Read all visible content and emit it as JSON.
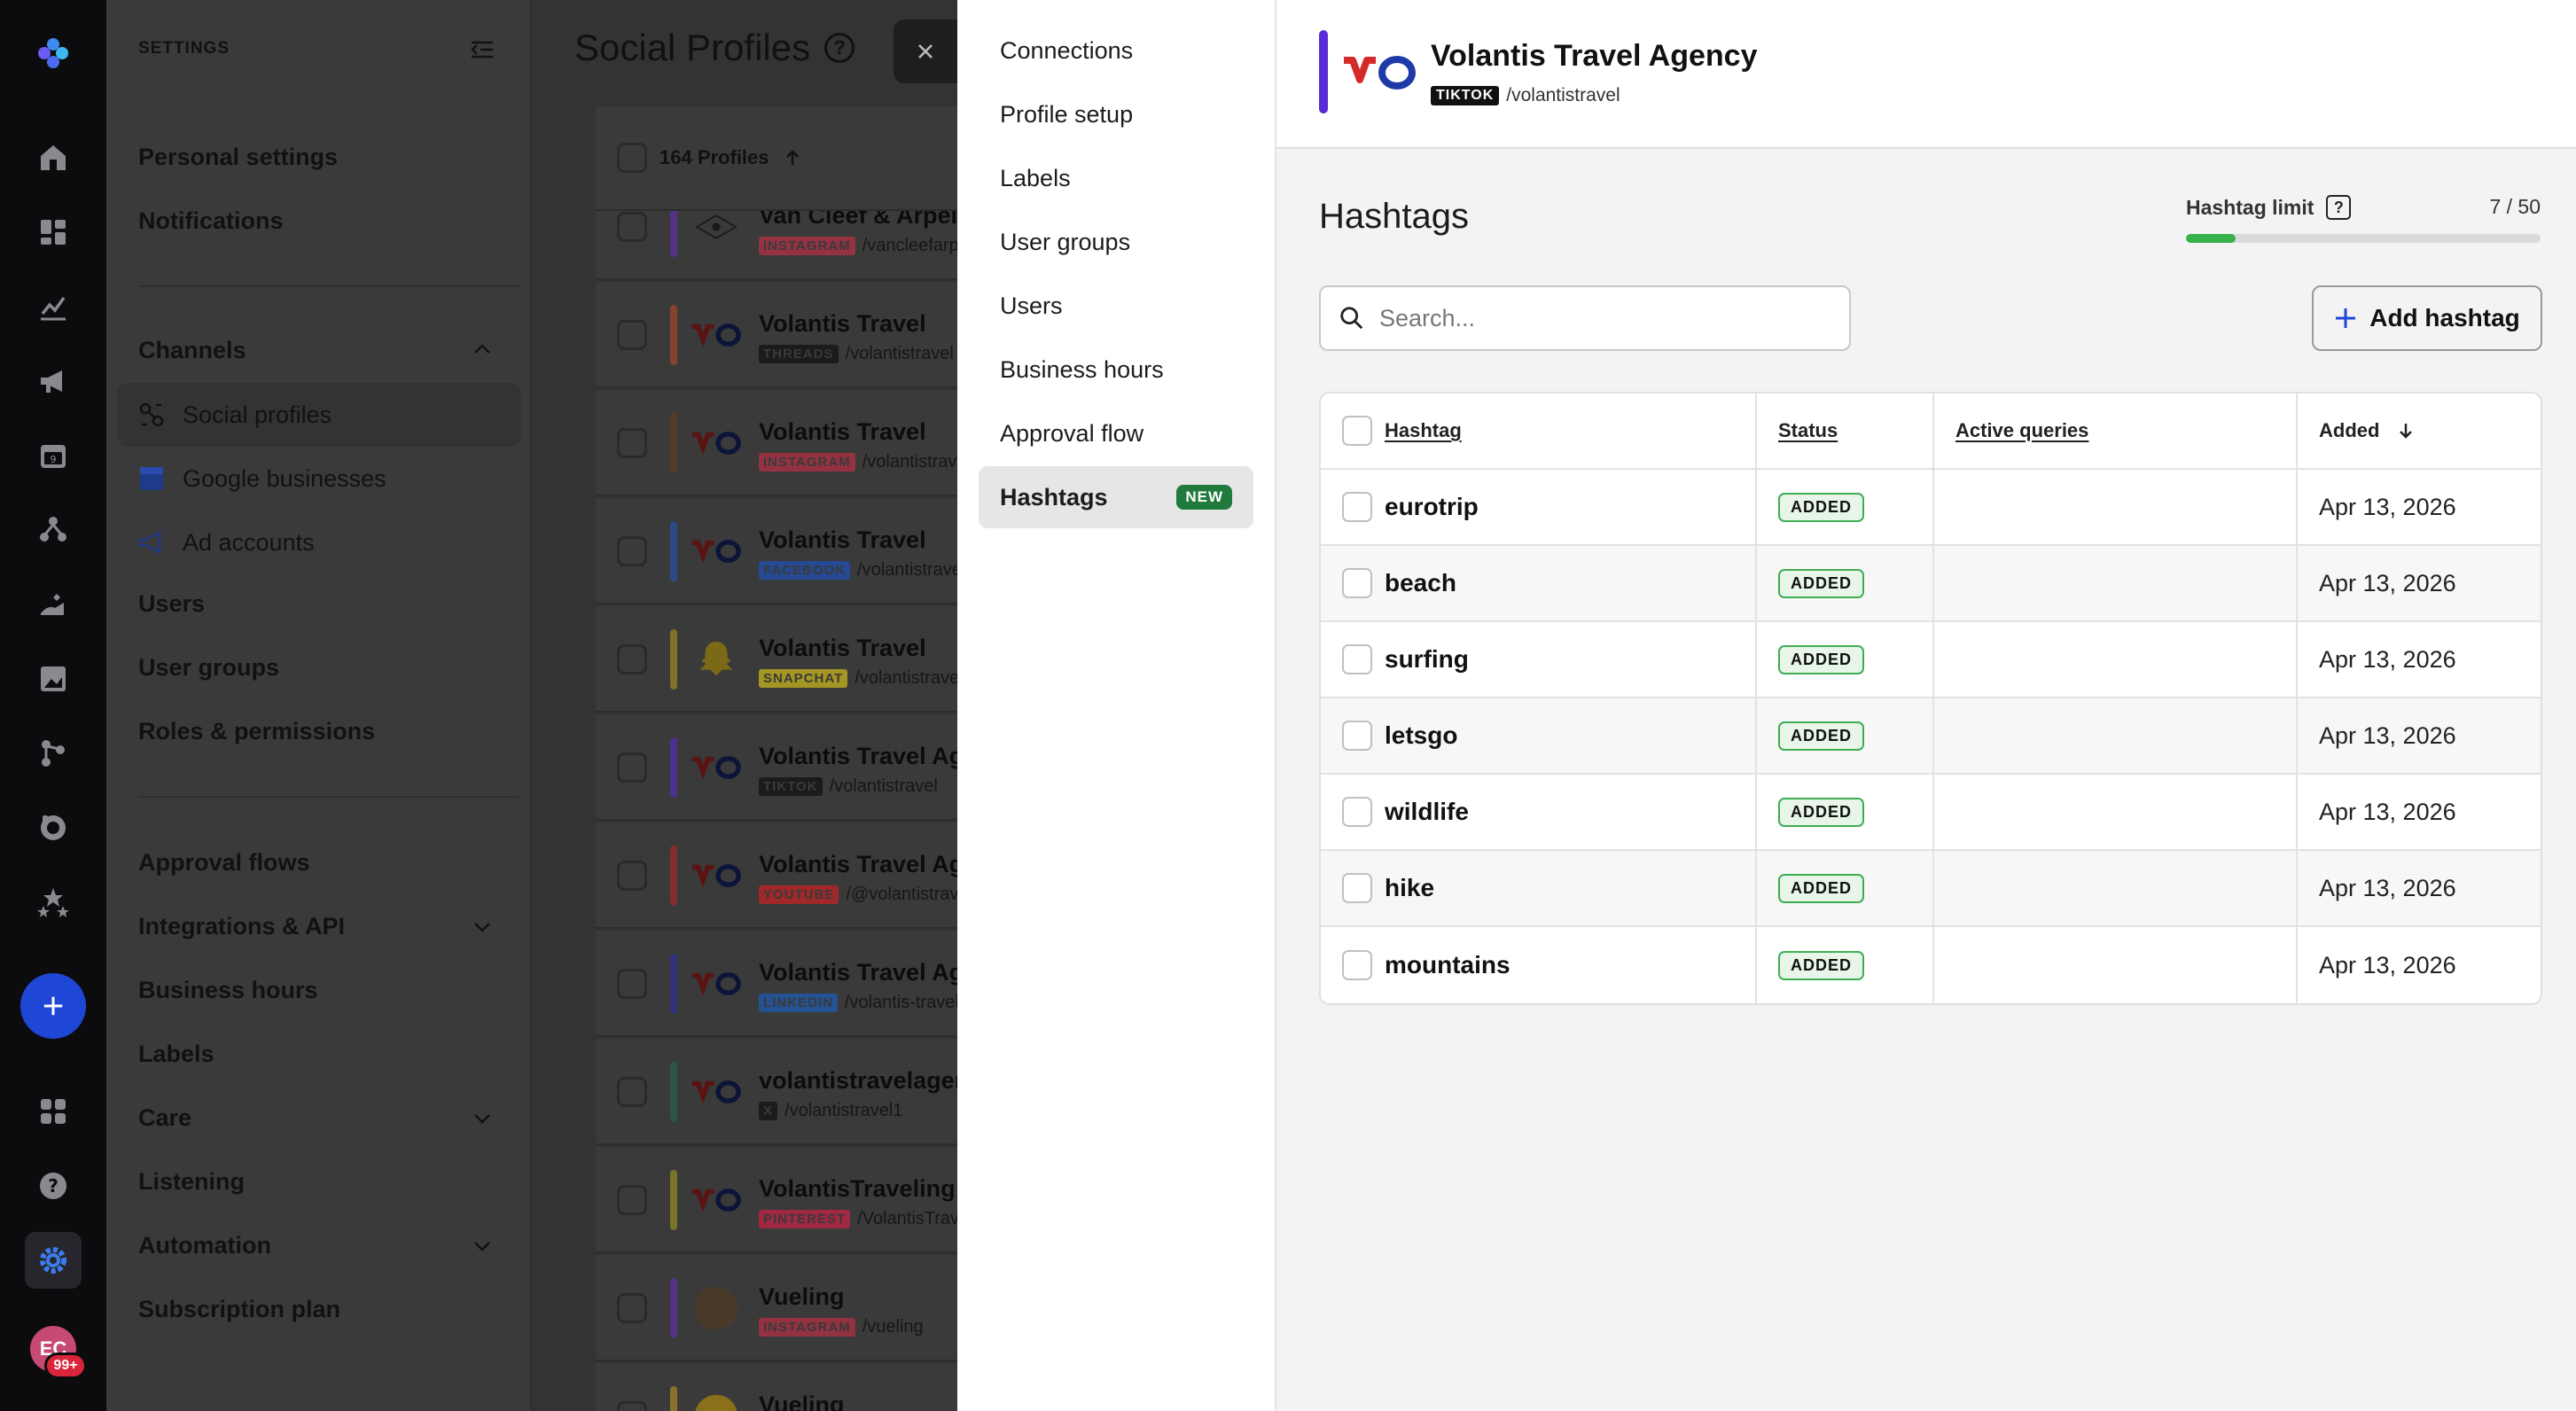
{
  "sidebar": {
    "header": "SETTINGS",
    "items": {
      "personal": "Personal settings",
      "notifications": "Notifications",
      "channels": "Channels",
      "social_profiles": "Social profiles",
      "google_businesses": "Google businesses",
      "ad_accounts": "Ad accounts",
      "users": "Users",
      "user_groups": "User groups",
      "roles": "Roles & permissions",
      "approval_flows": "Approval flows",
      "integrations": "Integrations & API",
      "business_hours": "Business hours",
      "labels": "Labels",
      "care": "Care",
      "listening": "Listening",
      "automation": "Automation",
      "subscription": "Subscription plan"
    }
  },
  "rail": {
    "avatar_initials": "EC",
    "avatar_badge": "99+"
  },
  "profiles": {
    "title": "Social Profiles",
    "help_mark": "?",
    "count_label": "164 Profiles",
    "rows": [
      {
        "name": "Van Cleef & Arpels",
        "platform": "INSTAGRAM",
        "handle": "/vancleefarpels",
        "stripe": "#6a2cc4",
        "tag_bg": "#b23045"
      },
      {
        "name": "Volantis Travel",
        "platform": "THREADS",
        "handle": "/volantistravel",
        "stripe": "#c24a22",
        "tag_bg": "#111111"
      },
      {
        "name": "Volantis Travel",
        "platform": "INSTAGRAM",
        "handle": "/volantistravel",
        "stripe": "#6a3a1e",
        "tag_bg": "#b23045"
      },
      {
        "name": "Volantis Travel",
        "platform": "FACEBOOK",
        "handle": "/volantistravel",
        "stripe": "#1e5ac4",
        "tag_bg": "#1e4fb0"
      },
      {
        "name": "Volantis Travel",
        "platform": "SNAPCHAT",
        "handle": "/volantistravel",
        "stripe": "#b8a01c",
        "tag_bg": "#c8b51c"
      },
      {
        "name": "Volantis Travel Agency",
        "platform": "TIKTOK",
        "handle": "/volantistravel",
        "stripe": "#5a2bd6",
        "tag_bg": "#111111"
      },
      {
        "name": "Volantis Travel Agency",
        "platform": "YOUTUBE",
        "handle": "/@volantistravel",
        "stripe": "#c42222",
        "tag_bg": "#c42222"
      },
      {
        "name": "Volantis Travel Agency",
        "platform": "LINKEDIN",
        "handle": "/volantis-travel",
        "stripe": "#2a30b0",
        "tag_bg": "#1e5ab0"
      },
      {
        "name": "volantistravelagency",
        "platform": "X",
        "handle": "/volantistravel1",
        "stripe": "#1e6e5a",
        "tag_bg": "#111111"
      },
      {
        "name": "VolantisTraveling",
        "platform": "PINTEREST",
        "handle": "/VolantisTraveling",
        "stripe": "#b0a21c",
        "tag_bg": "#c42244"
      },
      {
        "name": "Vueling",
        "platform": "INSTAGRAM",
        "handle": "/vueling",
        "stripe": "#6a2cc4",
        "tag_bg": "#b23045"
      },
      {
        "name": "Vueling",
        "platform": "",
        "handle": "",
        "stripe": "#c8a01c",
        "tag_bg": "#c8a01c"
      }
    ]
  },
  "panel_nav": {
    "items": [
      "Connections",
      "Profile setup",
      "Labels",
      "User groups",
      "Users",
      "Business hours",
      "Approval flow",
      "Hashtags"
    ],
    "active": "Hashtags",
    "new_badge": "NEW"
  },
  "profile_header": {
    "name": "Volantis Travel Agency",
    "platform": "TIKTOK",
    "handle": "/volantistravel",
    "accent": "#5a2bd6"
  },
  "hashtags": {
    "title": "Hashtags",
    "limit_label": "Hashtag limit",
    "limit_help": "?",
    "limit_value": "7 / 50",
    "limit_used": 7,
    "limit_max": 50,
    "search_placeholder": "Search...",
    "add_label": "Add hashtag",
    "columns": {
      "hashtag": "Hashtag",
      "status": "Status",
      "queries": "Active queries",
      "added": "Added"
    },
    "rows": [
      {
        "tag": "eurotrip",
        "status": "ADDED",
        "queries": "",
        "added": "Apr 13, 2026"
      },
      {
        "tag": "beach",
        "status": "ADDED",
        "queries": "",
        "added": "Apr 13, 2026"
      },
      {
        "tag": "surfing",
        "status": "ADDED",
        "queries": "",
        "added": "Apr 13, 2026"
      },
      {
        "tag": "letsgo",
        "status": "ADDED",
        "queries": "",
        "added": "Apr 13, 2026"
      },
      {
        "tag": "wildlife",
        "status": "ADDED",
        "queries": "",
        "added": "Apr 13, 2026"
      },
      {
        "tag": "hike",
        "status": "ADDED",
        "queries": "",
        "added": "Apr 13, 2026"
      },
      {
        "tag": "mountains",
        "status": "ADDED",
        "queries": "",
        "added": "Apr 13, 2026"
      }
    ]
  }
}
